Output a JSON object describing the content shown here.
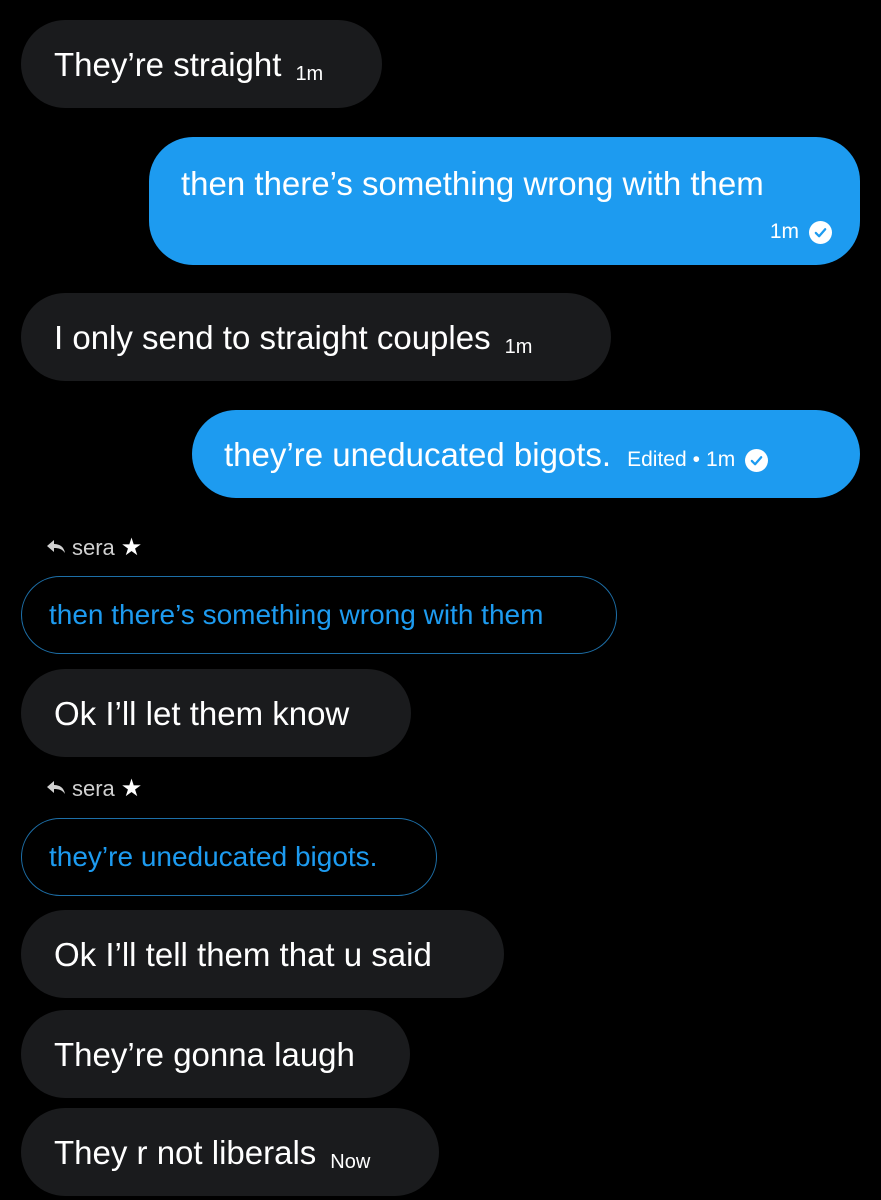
{
  "messages": [
    {
      "type": "incoming",
      "text": "They’re straight",
      "time": "1m"
    },
    {
      "type": "outgoing",
      "text": "then there’s something wrong with them",
      "time": "1m"
    },
    {
      "type": "incoming",
      "text": "I only send to straight couples",
      "time": "1m"
    },
    {
      "type": "outgoing",
      "text": "they’re uneducated bigots.",
      "edited": "Edited",
      "separator": "•",
      "time": "1m"
    },
    {
      "type": "reply_header",
      "name": "sera",
      "icon": "reply-arrow-icon",
      "badge": "star-icon"
    },
    {
      "type": "quote",
      "text": "then there’s something wrong with them"
    },
    {
      "type": "incoming",
      "text": "Ok I’ll let them know"
    },
    {
      "type": "reply_header",
      "name": "sera",
      "icon": "reply-arrow-icon",
      "badge": "star-icon"
    },
    {
      "type": "quote",
      "text": "they’re uneducated bigots."
    },
    {
      "type": "incoming",
      "text": "Ok I’ll tell them that u said"
    },
    {
      "type": "incoming",
      "text": "They’re gonna laugh"
    },
    {
      "type": "incoming",
      "text": "They r not liberals",
      "time": "Now"
    }
  ],
  "colors": {
    "background": "#000000",
    "incoming_bubble": "#1a1b1d",
    "outgoing_bubble": "#1d9bf0",
    "accent": "#1d9bf0"
  }
}
